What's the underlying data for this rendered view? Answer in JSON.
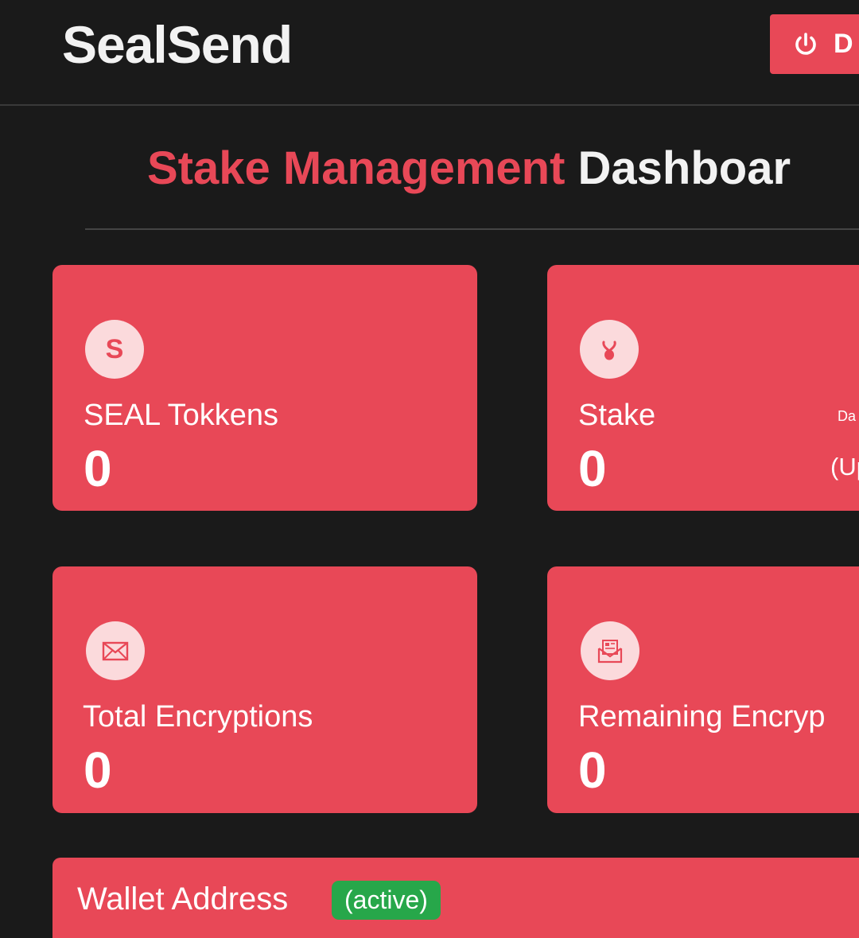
{
  "header": {
    "brand": "SealSend",
    "disconnect_label": "D"
  },
  "page": {
    "title_accent": "Stake Management",
    "title_main": "Dashboar"
  },
  "cards": {
    "seal_tokens": {
      "label": "SEAL Tokkens",
      "value": "0",
      "icon": "dollar-s-icon"
    },
    "stake": {
      "label": "Stake",
      "value": "0",
      "side_top": "Da",
      "side_bottom": "(Up",
      "icon": "seed-sprout-icon"
    },
    "total_encryptions": {
      "label": "Total Encryptions",
      "value": "0",
      "icon": "envelope-icon"
    },
    "remaining_encryptions": {
      "label": "Remaining Encryp",
      "value": "0",
      "icon": "open-letter-icon"
    }
  },
  "wallet": {
    "label": "Wallet Address",
    "status": "(active)"
  },
  "colors": {
    "accent": "#e84857",
    "background": "#1a1a1a",
    "icon_bg": "#fbdadc",
    "active_badge": "#27a74a"
  }
}
